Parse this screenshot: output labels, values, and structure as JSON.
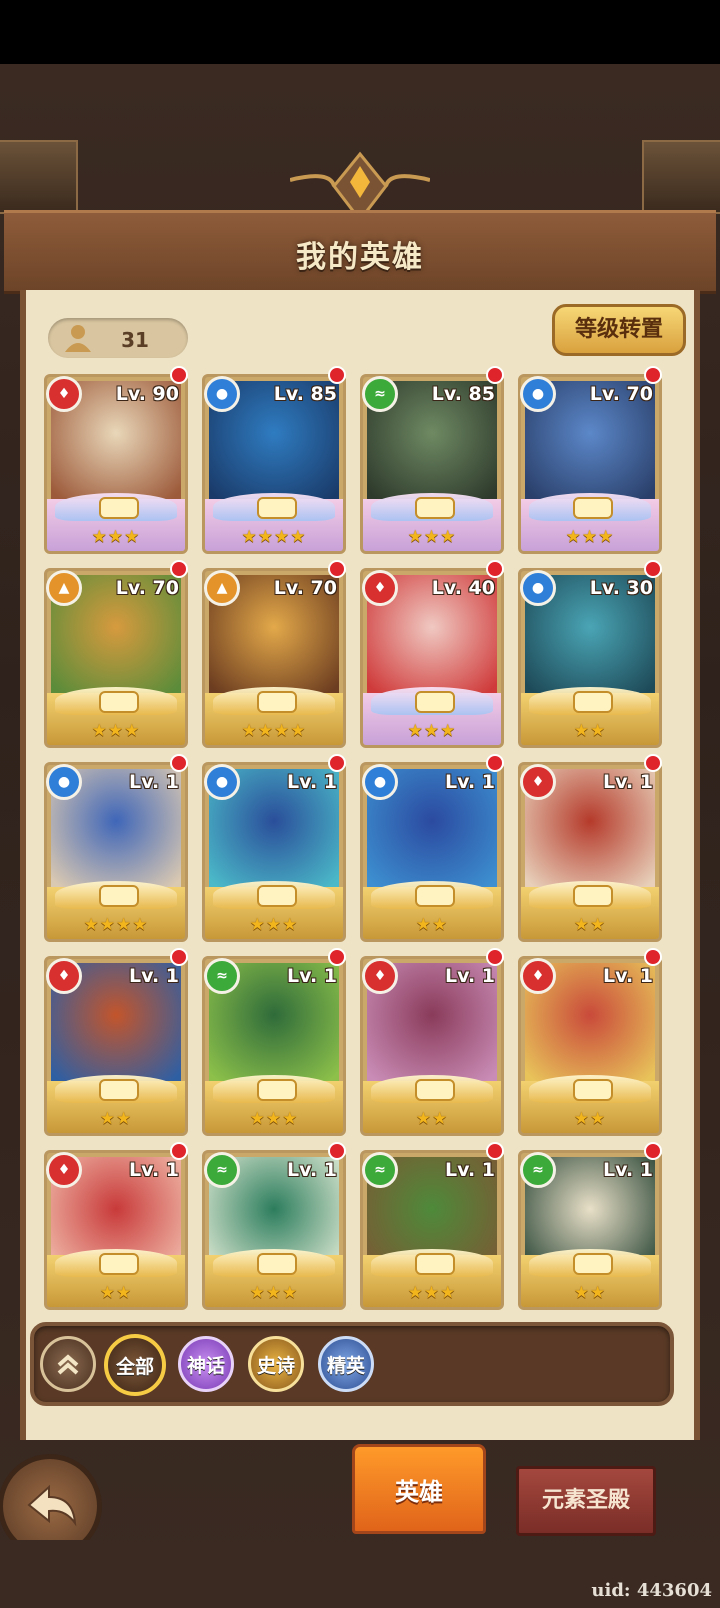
{
  "header": {
    "title": "我的英雄"
  },
  "hero_count": "31",
  "level_transfer_label": "等级转置",
  "heroes": [
    {
      "level": "Lv. 90",
      "element": "fire",
      "stars": "★★★",
      "rarity": "mythic",
      "c1": "#e9d7b9",
      "c2": "#9c5a3a"
    },
    {
      "level": "Lv. 85",
      "element": "water",
      "stars": "★★★★",
      "rarity": "mythic",
      "c1": "#2f7cc1",
      "c2": "#1a3b6a"
    },
    {
      "level": "Lv. 85",
      "element": "wind",
      "stars": "★★★",
      "rarity": "mythic",
      "c1": "#6f8a63",
      "c2": "#2e3a2c"
    },
    {
      "level": "Lv. 70",
      "element": "water",
      "stars": "★★★",
      "rarity": "mythic",
      "c1": "#5c88c9",
      "c2": "#2a3f6a"
    },
    {
      "level": "Lv. 70",
      "element": "earth",
      "stars": "★★★",
      "rarity": "epic",
      "c1": "#d79a3e",
      "c2": "#5b8c3a"
    },
    {
      "level": "Lv. 70",
      "element": "earth",
      "stars": "★★★★",
      "rarity": "epic",
      "c1": "#e3a94a",
      "c2": "#6c3d20"
    },
    {
      "level": "Lv. 40",
      "element": "fire",
      "stars": "★★★",
      "rarity": "mythic",
      "c1": "#f0c9c2",
      "c2": "#cf3a3a"
    },
    {
      "level": "Lv. 30",
      "element": "water",
      "stars": "★★",
      "rarity": "epic",
      "c1": "#4aa5b5",
      "c2": "#1e4a58"
    },
    {
      "level": "Lv. 1",
      "element": "water",
      "stars": "★★★★",
      "rarity": "epic",
      "c1": "#3f66b8",
      "c2": "#d9c8b2"
    },
    {
      "level": "Lv. 1",
      "element": "water",
      "stars": "★★★",
      "rarity": "epic",
      "c1": "#2a4e9a",
      "c2": "#4bb9c8"
    },
    {
      "level": "Lv. 1",
      "element": "water",
      "stars": "★★",
      "rarity": "epic",
      "c1": "#2b4aa0",
      "c2": "#3d8fd0"
    },
    {
      "level": "Lv. 1",
      "element": "fire",
      "stars": "★★",
      "rarity": "epic",
      "c1": "#b53a2b",
      "c2": "#e7cfb9"
    },
    {
      "level": "Lv. 1",
      "element": "fire",
      "stars": "★★",
      "rarity": "epic",
      "c1": "#c3552b",
      "c2": "#2f5fa3"
    },
    {
      "level": "Lv. 1",
      "element": "wind",
      "stars": "★★★",
      "rarity": "epic",
      "c1": "#2f6b3a",
      "c2": "#8cc04a"
    },
    {
      "level": "Lv. 1",
      "element": "fire",
      "stars": "★★",
      "rarity": "epic",
      "c1": "#8a3b5a",
      "c2": "#c98cb6"
    },
    {
      "level": "Lv. 1",
      "element": "fire",
      "stars": "★★",
      "rarity": "epic",
      "c1": "#c94a3a",
      "c2": "#e8c35a"
    },
    {
      "level": "Lv. 1",
      "element": "fire",
      "stars": "★★",
      "rarity": "epic",
      "c1": "#c83a3a",
      "c2": "#f0b9a9"
    },
    {
      "level": "Lv. 1",
      "element": "wind",
      "stars": "★★★",
      "rarity": "epic",
      "c1": "#2c7d5d",
      "c2": "#d9e6d0"
    },
    {
      "level": "Lv. 1",
      "element": "wind",
      "stars": "★★★",
      "rarity": "epic",
      "c1": "#4e8a3a",
      "c2": "#7a5a34"
    },
    {
      "level": "Lv. 1",
      "element": "wind",
      "stars": "★★",
      "rarity": "epic",
      "c1": "#e9e0c8",
      "c2": "#2f4a3a"
    }
  ],
  "filters": {
    "collapse": "",
    "all": "全部",
    "mythic": "神话",
    "epic": "史诗",
    "elite": "精英"
  },
  "tabs": {
    "hero": "英雄",
    "temple": "元素圣殿"
  },
  "uid": "uid: 443604",
  "colors": {
    "fire": "#d82f2f",
    "water": "#2f7fd8",
    "wind": "#3caa3a",
    "earth": "#e3932a"
  }
}
